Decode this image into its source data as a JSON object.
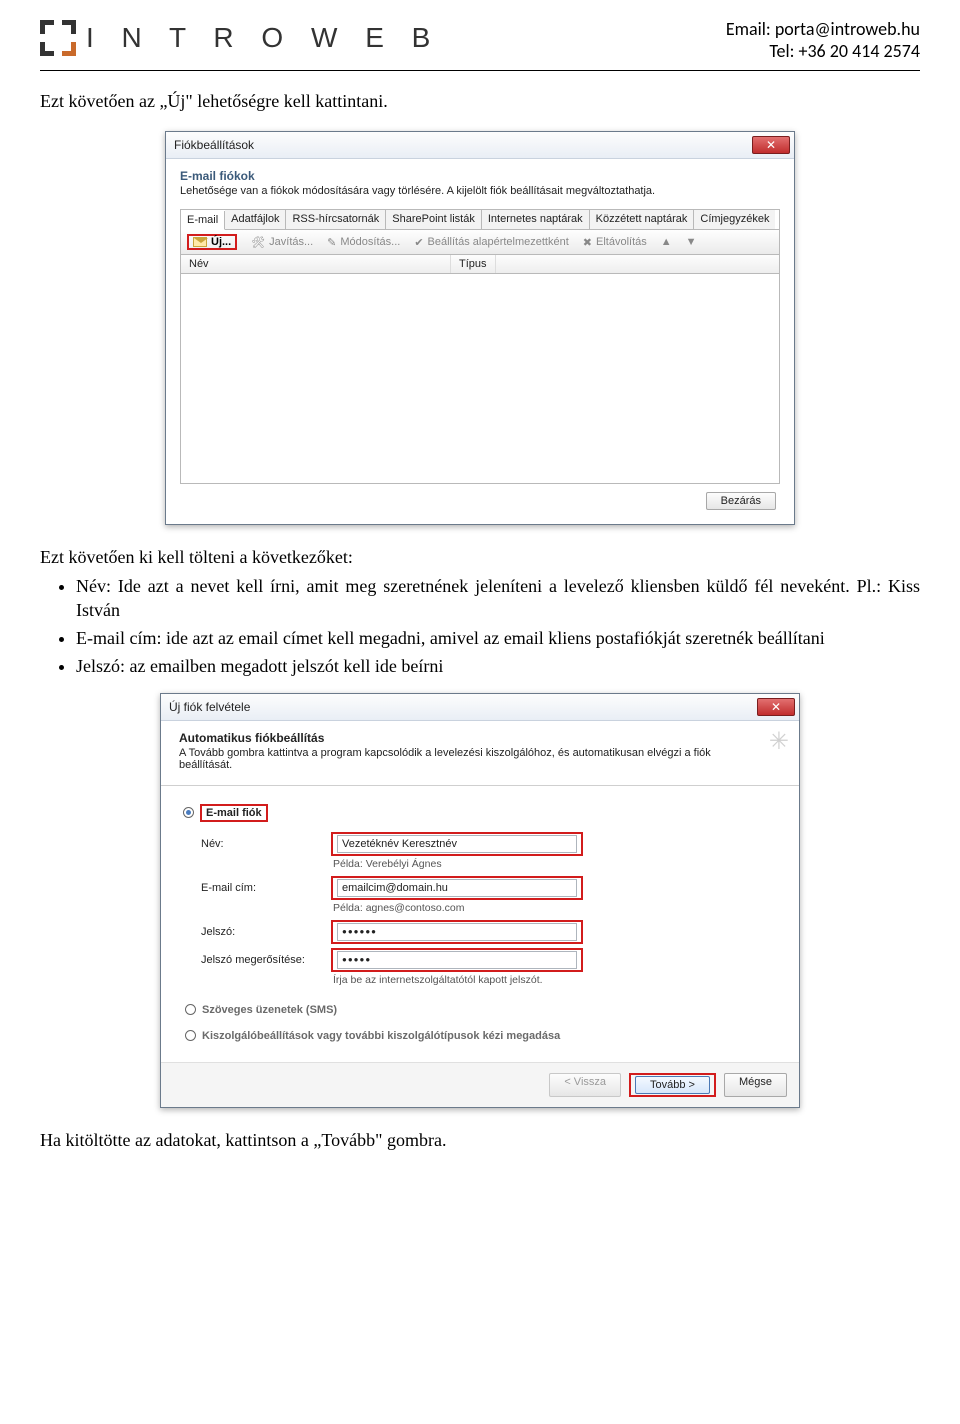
{
  "header": {
    "logo_text": "I N T R O W E B",
    "email_line": "Email: porta@introweb.hu",
    "tel_line": "Tel: +36 20 414 2574"
  },
  "text": {
    "before_dialog1": "Ezt követően az „Új\" lehetőségre kell kattintani.",
    "after_dialog1": "Ezt követően ki kell tölteni a következőket:",
    "bullet1": "Név: Ide azt a nevet kell írni, amit meg szeretnének jeleníteni a levelező kliensben küldő fél neveként. Pl.: Kiss István",
    "bullet2": "E-mail cím: ide azt az email címet kell megadni, amivel az email kliens postafiókját szeretnék beállítani",
    "bullet3": "Jelszó: az emailben megadott jelszót kell ide beírni",
    "after_dialog2": "Ha kitöltötte az adatokat, kattintson a „Tovább\" gombra."
  },
  "dlg1": {
    "title": "Fiókbeállítások",
    "section_heading": "E-mail fiókok",
    "section_sub": "Lehetősége van a fiókok módosítására vagy törlésére. A kijelölt fiók beállításait megváltoztathatja.",
    "tabs": [
      "E-mail",
      "Adatfájlok",
      "RSS-hírcsatornák",
      "SharePoint listák",
      "Internetes naptárak",
      "Közzétett naptárak",
      "Címjegyzékek"
    ],
    "toolbar": {
      "uj": "Új...",
      "javitas": "Javítás...",
      "modositas": "Módosítás...",
      "alap": "Beállítás alapértelmezettként",
      "eltav": "Eltávolítás"
    },
    "columns": {
      "nev": "Név",
      "tipus": "Típus"
    },
    "close_button": "Bezárás"
  },
  "dlg2": {
    "title": "Új fiók felvétele",
    "head_bold": "Automatikus fiókbeállítás",
    "head_sub": "A Tovább gombra kattintva a program kapcsolódik a levelezési kiszolgálóhoz, és automatikusan elvégzi a fiók beállítását.",
    "radio_email": "E-mail fiók",
    "labels": {
      "nev": "Név:",
      "email": "E-mail cím:",
      "jelszo": "Jelszó:",
      "jelszo2": "Jelszó megerősítése:"
    },
    "values": {
      "nev": "Vezetéknév Keresztnév",
      "email": "emailcim@domain.hu",
      "jelszo": "●●●●●●",
      "jelszo2": "●●●●●"
    },
    "hints": {
      "nev": "Példa: Verebélyi Ágnes",
      "email": "Példa: agnes@contoso.com",
      "jelszo2": "Írja be az internetszolgáltatótól kapott jelszót."
    },
    "radio_sms": "Szöveges üzenetek (SMS)",
    "radio_manual": "Kiszolgálóbeállítások vagy további kiszolgálótípusok kézi megadása",
    "buttons": {
      "back": "< Vissza",
      "next": "Tovább >",
      "cancel": "Mégse"
    }
  }
}
